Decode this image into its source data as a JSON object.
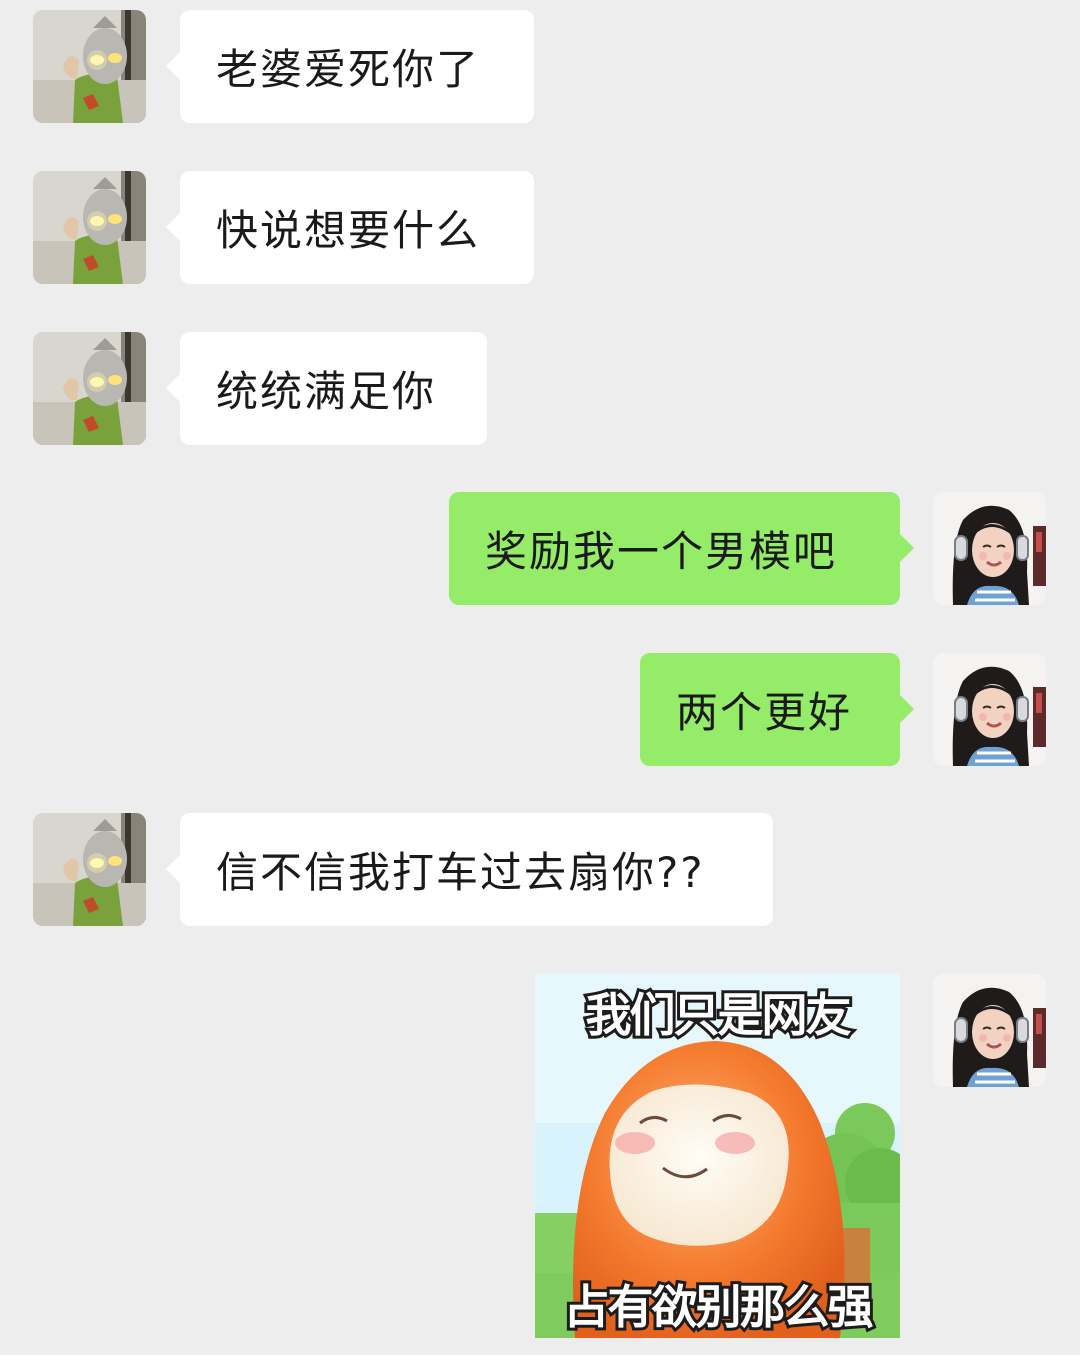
{
  "chat": {
    "messages": [
      {
        "side": "in",
        "text": "老婆爱死你了"
      },
      {
        "side": "in",
        "text": "快说想要什么"
      },
      {
        "side": "in",
        "text": "统统满足你"
      },
      {
        "side": "out",
        "text": "奖励我一个男模吧"
      },
      {
        "side": "out",
        "text": "两个更好"
      },
      {
        "side": "in",
        "text": "信不信我打车过去扇你??"
      },
      {
        "side": "out",
        "type": "sticker",
        "caption_top": "我们只是网友",
        "caption_bottom": "占有欲别那么强"
      }
    ]
  },
  "colors": {
    "background": "#ededed",
    "incoming_bubble": "#ffffff",
    "outgoing_bubble": "#95ec69"
  },
  "icons": {
    "contact_avatar": "ultraman-avatar-icon",
    "self_avatar": "girl-headphones-avatar-icon"
  }
}
